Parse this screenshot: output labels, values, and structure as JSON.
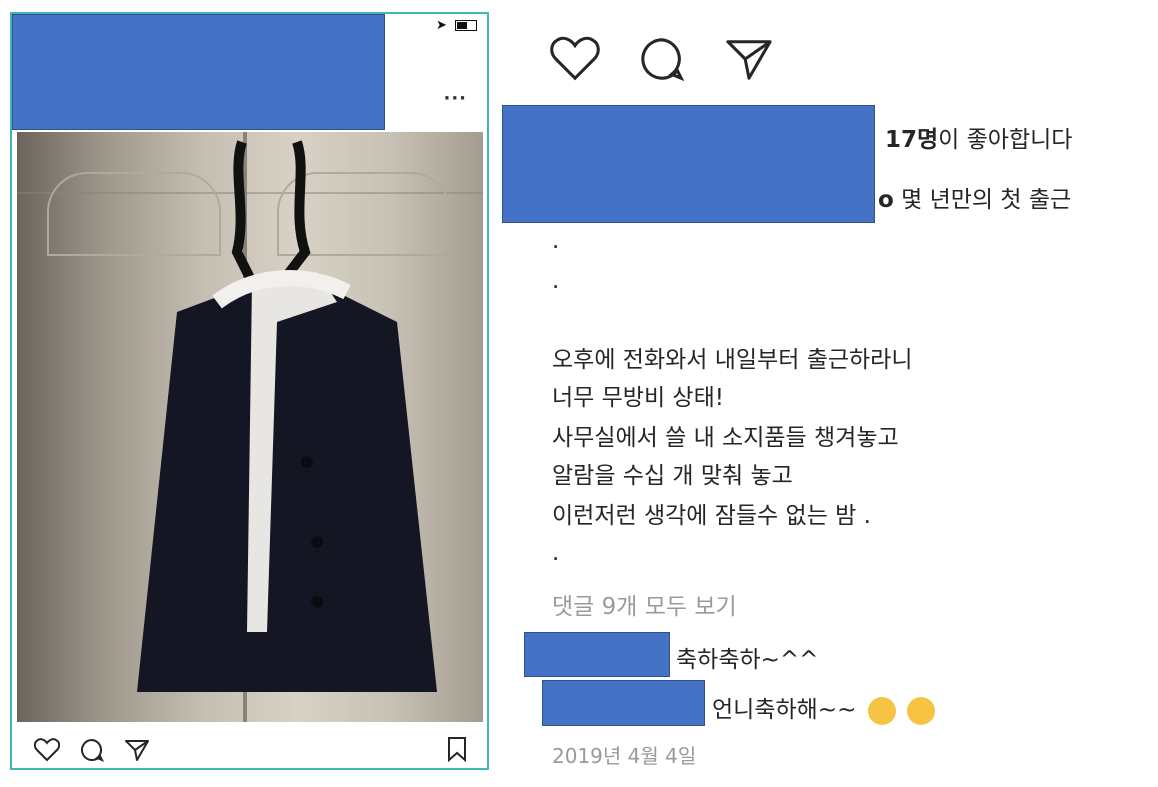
{
  "left_phone": {
    "icons": [
      "location-arrow-icon",
      "battery-icon",
      "more-icon",
      "heart-icon",
      "comment-icon",
      "share-icon",
      "bookmark-icon"
    ]
  },
  "right_post": {
    "likes_count": "17명",
    "likes_suffix": "이 좋아합니다",
    "caption_end": "o",
    "caption_first_line": " 몇 년만의 첫 출근",
    "dot1": ".",
    "dot2": ".",
    "body": [
      "오후에 전화와서 내일부터 출근하라니",
      "너무 무방비 상태!",
      "사무실에서 쓸 내 소지품들 챙겨놓고",
      "알람을 수십 개 맞춰 놓고",
      "이런저런 생각에 잠들수 없는 밤 ."
    ],
    "dot3": ".",
    "view_comments": "댓글 9개 모두 보기",
    "comments": [
      {
        "text": "축하축하~^^"
      },
      {
        "text": "언니축하해~~"
      }
    ],
    "date": "2019년 4월 4일"
  }
}
